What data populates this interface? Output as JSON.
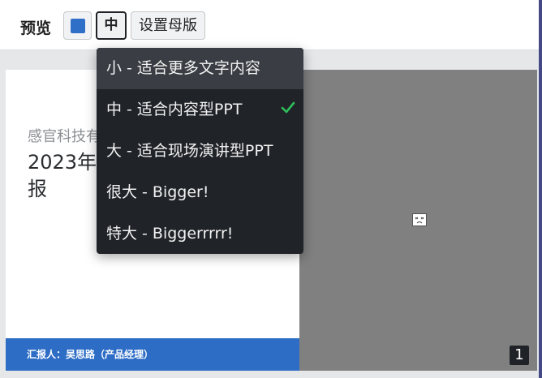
{
  "toolbar": {
    "title": "预览",
    "color_swatch": "#2f6fc8",
    "size_button_label": "中",
    "master_button_label": "设置母版"
  },
  "dropdown": {
    "items": [
      {
        "label": "小 - 适合更多文字内容",
        "selected": false
      },
      {
        "label": "中 - 适合内容型PPT",
        "selected": true
      },
      {
        "label": "大 - 适合现场演讲型PPT",
        "selected": false
      },
      {
        "label": "很大 - Bigger!",
        "selected": false
      },
      {
        "label": "特大 - Biggerrrrr!",
        "selected": false
      }
    ],
    "check_color": "#2fbf5a"
  },
  "slide": {
    "company": "感官科技有",
    "headline": "2023年\n报",
    "reporter": "汇报人：吴思路（产品经理）",
    "accent": "#2d6dc6",
    "page_number": "1"
  }
}
